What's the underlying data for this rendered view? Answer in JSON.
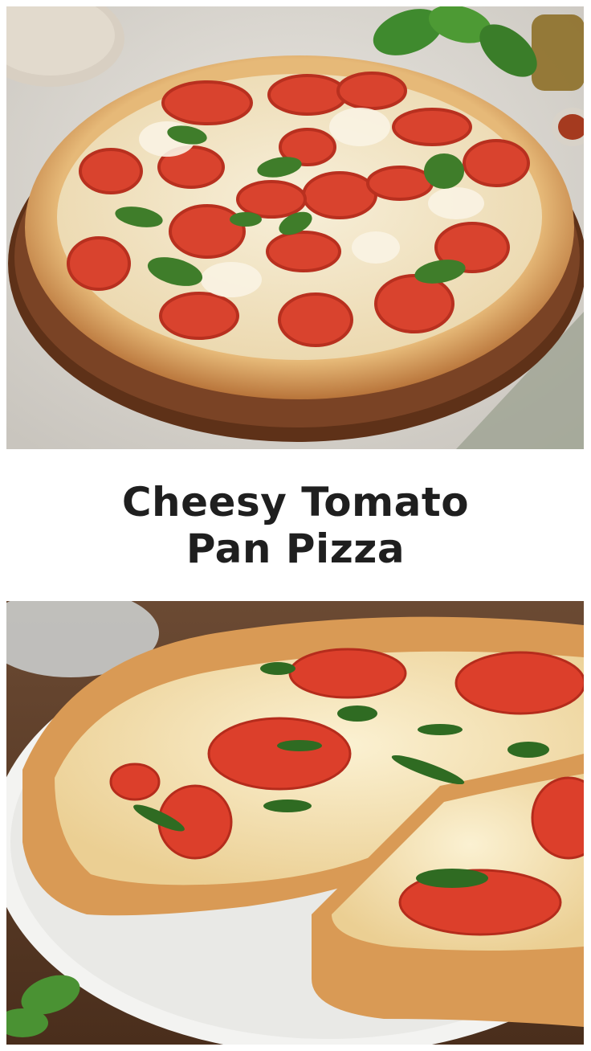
{
  "title": {
    "line1": "Cheesy Tomato",
    "line2": "Pan Pizza"
  },
  "images": {
    "top": "whole-pizza-photo",
    "bottom": "sliced-pizza-photo"
  },
  "colors": {
    "title_text": "#1f1f1f",
    "background": "#ffffff",
    "tomato": "#d9432e",
    "crust": "#d99a55",
    "basil": "#3f7d2a",
    "cheese": "#f4ead2",
    "wood_board": "#7a4325"
  }
}
